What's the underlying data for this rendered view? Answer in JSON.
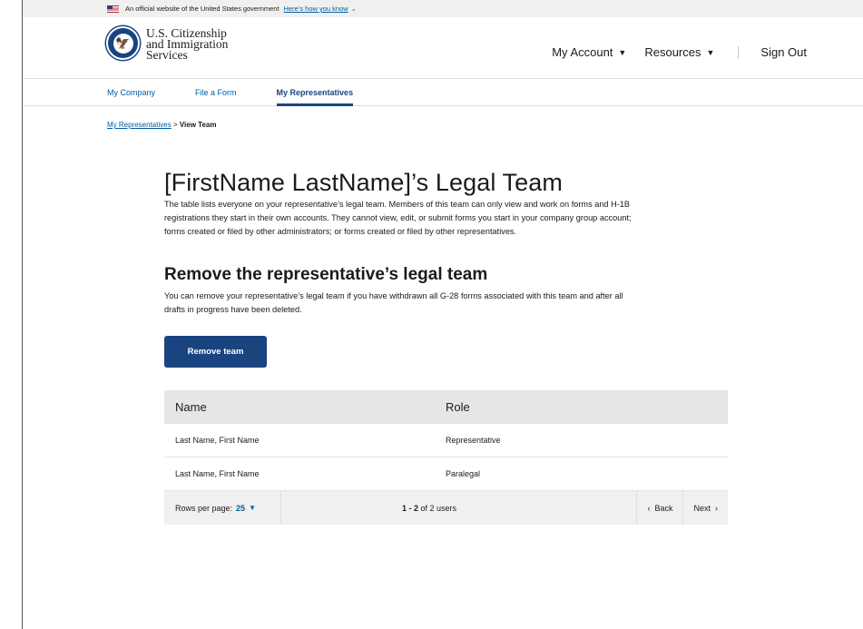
{
  "gov_banner": {
    "text": "An official website of the United States government",
    "link": "Here’s how you know"
  },
  "header": {
    "agency_line1": "U.S. Citizenship",
    "agency_line2": "and Immigration",
    "agency_line3": "Services",
    "nav": [
      {
        "label": "My Account"
      },
      {
        "label": "Resources"
      }
    ],
    "sign_out": "Sign Out"
  },
  "tabs": [
    {
      "label": "My Company",
      "active": false
    },
    {
      "label": "File a Form",
      "active": false
    },
    {
      "label": "My Representatives",
      "active": true
    }
  ],
  "breadcrumb": {
    "parent": "My Representatives",
    "separator": ">",
    "current": "View Team"
  },
  "main": {
    "title": "[FirstName LastName]’s Legal Team",
    "intro_line1": "The table lists everyone on your representative’s legal team. Members of this team can only view and work on forms and H-1B",
    "intro_line2": "registrations they start in their own accounts. They cannot view, edit, or submit forms you start in your company group account;",
    "intro_line3": "forms created or filed by other administrators; or forms created or filed by other representatives.",
    "section_title": "Remove the representative’s legal team",
    "section_desc_line1": "You can remove your representative’s legal team if you have withdrawn all G-28 forms associated with this team and after all",
    "section_desc_line2": "drafts in progress have been deleted.",
    "remove_button": "Remove team"
  },
  "table": {
    "columns": [
      "Name",
      "Role"
    ],
    "rows": [
      {
        "name": "Last Name, First Name",
        "role": "Representative"
      },
      {
        "name": "Last Name, First Name",
        "role": "Paralegal"
      }
    ],
    "rows_per_page_label": "Rows per page:",
    "rows_per_page_value": "25",
    "count_range": "1 - 2",
    "count_suffix": "of 2 users",
    "back": "Back",
    "next": "Next"
  }
}
